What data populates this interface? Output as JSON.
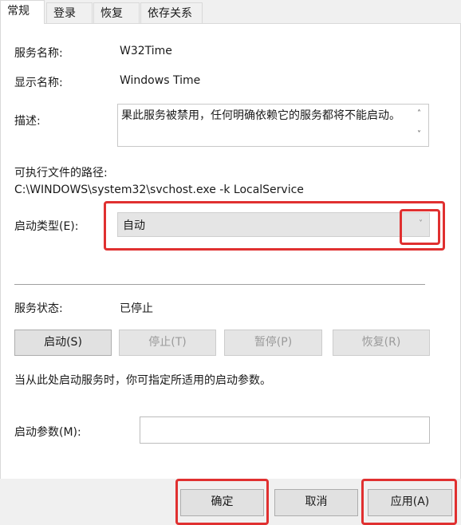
{
  "tabs": [
    {
      "label": "常规",
      "active": true
    },
    {
      "label": "登录",
      "active": false
    },
    {
      "label": "恢复",
      "active": false
    },
    {
      "label": "依存关系",
      "active": false
    }
  ],
  "general": {
    "service_name_label": "服务名称:",
    "service_name_value": "W32Time",
    "display_name_label": "显示名称:",
    "display_name_value": "Windows Time",
    "description_label": "描述:",
    "description_value": "果此服务被禁用，任何明确依赖它的服务都将不能启动。",
    "exe_path_label": "可执行文件的路径:",
    "exe_path_value": "C:\\WINDOWS\\system32\\svchost.exe -k LocalService",
    "startup_type_label": "启动类型(E):",
    "startup_type_value": "自动",
    "service_status_label": "服务状态:",
    "service_status_value": "已停止",
    "start_params_hint": "当从此处启动服务时，你可指定所适用的启动参数。",
    "start_params_label": "启动参数(M):",
    "start_params_value": ""
  },
  "control_buttons": {
    "start": "启动(S)",
    "stop": "停止(T)",
    "pause": "暂停(P)",
    "resume": "恢复(R)"
  },
  "footer_buttons": {
    "ok": "确定",
    "cancel": "取消",
    "apply": "应用(A)"
  },
  "colors": {
    "highlight": "#e03030"
  }
}
